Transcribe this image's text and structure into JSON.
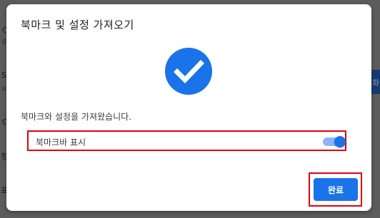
{
  "background": {
    "fragments": [
      {
        "text": "C"
      },
      {
        "text": "0"
      },
      {
        "text": "S"
      },
      {
        "text": "u"
      },
      {
        "text": "G"
      },
      {
        "text": "정"
      },
      {
        "text": "표"
      }
    ],
    "right_button_text": "화"
  },
  "dialog": {
    "title": "북마크 및 설정 가져오기",
    "icon": "check-circle-icon",
    "result_message": "북마크와 설정을 가져왔습니다.",
    "bookmark_bar_toggle": {
      "label": "북마크바 표시",
      "on": true
    },
    "done_button": "완료"
  },
  "colors": {
    "accent": "#1a73e8",
    "toggle_track": "#8ab4f8",
    "highlight_box": "#e0000f",
    "overlay": "#5c5c5c"
  }
}
